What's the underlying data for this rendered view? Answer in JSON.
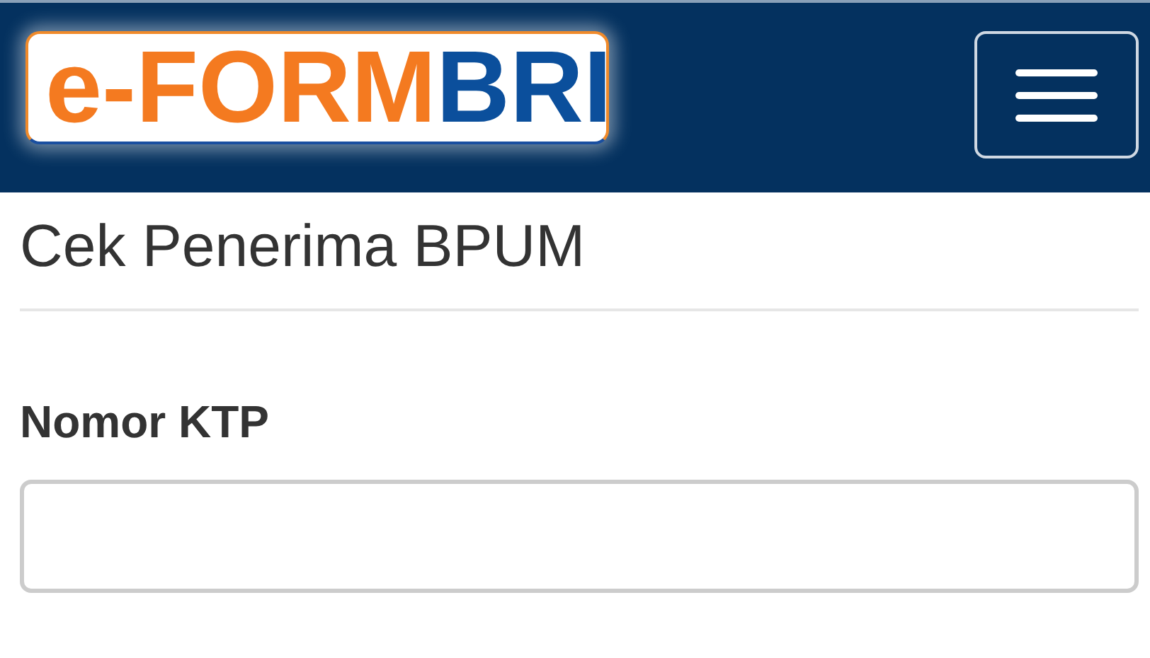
{
  "header": {
    "logo": {
      "prefix": "e-FORM",
      "suffix": "BRI"
    },
    "menu_button": {
      "kind": "hamburger"
    }
  },
  "page_title": "Cek Penerima BPUM",
  "form": {
    "fields": [
      {
        "label": "Nomor KTP"
      }
    ]
  }
}
